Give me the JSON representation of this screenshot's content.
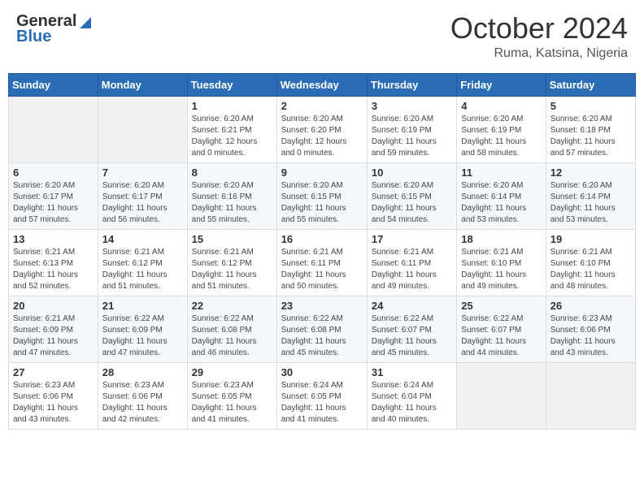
{
  "header": {
    "logo_general": "General",
    "logo_blue": "Blue",
    "month_title": "October 2024",
    "location": "Ruma, Katsina, Nigeria"
  },
  "days_of_week": [
    "Sunday",
    "Monday",
    "Tuesday",
    "Wednesday",
    "Thursday",
    "Friday",
    "Saturday"
  ],
  "weeks": [
    [
      {
        "day": "",
        "info": ""
      },
      {
        "day": "",
        "info": ""
      },
      {
        "day": "1",
        "info": "Sunrise: 6:20 AM\nSunset: 6:21 PM\nDaylight: 12 hours\nand 0 minutes."
      },
      {
        "day": "2",
        "info": "Sunrise: 6:20 AM\nSunset: 6:20 PM\nDaylight: 12 hours\nand 0 minutes."
      },
      {
        "day": "3",
        "info": "Sunrise: 6:20 AM\nSunset: 6:19 PM\nDaylight: 11 hours\nand 59 minutes."
      },
      {
        "day": "4",
        "info": "Sunrise: 6:20 AM\nSunset: 6:19 PM\nDaylight: 11 hours\nand 58 minutes."
      },
      {
        "day": "5",
        "info": "Sunrise: 6:20 AM\nSunset: 6:18 PM\nDaylight: 11 hours\nand 57 minutes."
      }
    ],
    [
      {
        "day": "6",
        "info": "Sunrise: 6:20 AM\nSunset: 6:17 PM\nDaylight: 11 hours\nand 57 minutes."
      },
      {
        "day": "7",
        "info": "Sunrise: 6:20 AM\nSunset: 6:17 PM\nDaylight: 11 hours\nand 56 minutes."
      },
      {
        "day": "8",
        "info": "Sunrise: 6:20 AM\nSunset: 6:16 PM\nDaylight: 11 hours\nand 55 minutes."
      },
      {
        "day": "9",
        "info": "Sunrise: 6:20 AM\nSunset: 6:15 PM\nDaylight: 11 hours\nand 55 minutes."
      },
      {
        "day": "10",
        "info": "Sunrise: 6:20 AM\nSunset: 6:15 PM\nDaylight: 11 hours\nand 54 minutes."
      },
      {
        "day": "11",
        "info": "Sunrise: 6:20 AM\nSunset: 6:14 PM\nDaylight: 11 hours\nand 53 minutes."
      },
      {
        "day": "12",
        "info": "Sunrise: 6:20 AM\nSunset: 6:14 PM\nDaylight: 11 hours\nand 53 minutes."
      }
    ],
    [
      {
        "day": "13",
        "info": "Sunrise: 6:21 AM\nSunset: 6:13 PM\nDaylight: 11 hours\nand 52 minutes."
      },
      {
        "day": "14",
        "info": "Sunrise: 6:21 AM\nSunset: 6:12 PM\nDaylight: 11 hours\nand 51 minutes."
      },
      {
        "day": "15",
        "info": "Sunrise: 6:21 AM\nSunset: 6:12 PM\nDaylight: 11 hours\nand 51 minutes."
      },
      {
        "day": "16",
        "info": "Sunrise: 6:21 AM\nSunset: 6:11 PM\nDaylight: 11 hours\nand 50 minutes."
      },
      {
        "day": "17",
        "info": "Sunrise: 6:21 AM\nSunset: 6:11 PM\nDaylight: 11 hours\nand 49 minutes."
      },
      {
        "day": "18",
        "info": "Sunrise: 6:21 AM\nSunset: 6:10 PM\nDaylight: 11 hours\nand 49 minutes."
      },
      {
        "day": "19",
        "info": "Sunrise: 6:21 AM\nSunset: 6:10 PM\nDaylight: 11 hours\nand 48 minutes."
      }
    ],
    [
      {
        "day": "20",
        "info": "Sunrise: 6:21 AM\nSunset: 6:09 PM\nDaylight: 11 hours\nand 47 minutes."
      },
      {
        "day": "21",
        "info": "Sunrise: 6:22 AM\nSunset: 6:09 PM\nDaylight: 11 hours\nand 47 minutes."
      },
      {
        "day": "22",
        "info": "Sunrise: 6:22 AM\nSunset: 6:08 PM\nDaylight: 11 hours\nand 46 minutes."
      },
      {
        "day": "23",
        "info": "Sunrise: 6:22 AM\nSunset: 6:08 PM\nDaylight: 11 hours\nand 45 minutes."
      },
      {
        "day": "24",
        "info": "Sunrise: 6:22 AM\nSunset: 6:07 PM\nDaylight: 11 hours\nand 45 minutes."
      },
      {
        "day": "25",
        "info": "Sunrise: 6:22 AM\nSunset: 6:07 PM\nDaylight: 11 hours\nand 44 minutes."
      },
      {
        "day": "26",
        "info": "Sunrise: 6:23 AM\nSunset: 6:06 PM\nDaylight: 11 hours\nand 43 minutes."
      }
    ],
    [
      {
        "day": "27",
        "info": "Sunrise: 6:23 AM\nSunset: 6:06 PM\nDaylight: 11 hours\nand 43 minutes."
      },
      {
        "day": "28",
        "info": "Sunrise: 6:23 AM\nSunset: 6:06 PM\nDaylight: 11 hours\nand 42 minutes."
      },
      {
        "day": "29",
        "info": "Sunrise: 6:23 AM\nSunset: 6:05 PM\nDaylight: 11 hours\nand 41 minutes."
      },
      {
        "day": "30",
        "info": "Sunrise: 6:24 AM\nSunset: 6:05 PM\nDaylight: 11 hours\nand 41 minutes."
      },
      {
        "day": "31",
        "info": "Sunrise: 6:24 AM\nSunset: 6:04 PM\nDaylight: 11 hours\nand 40 minutes."
      },
      {
        "day": "",
        "info": ""
      },
      {
        "day": "",
        "info": ""
      }
    ]
  ]
}
